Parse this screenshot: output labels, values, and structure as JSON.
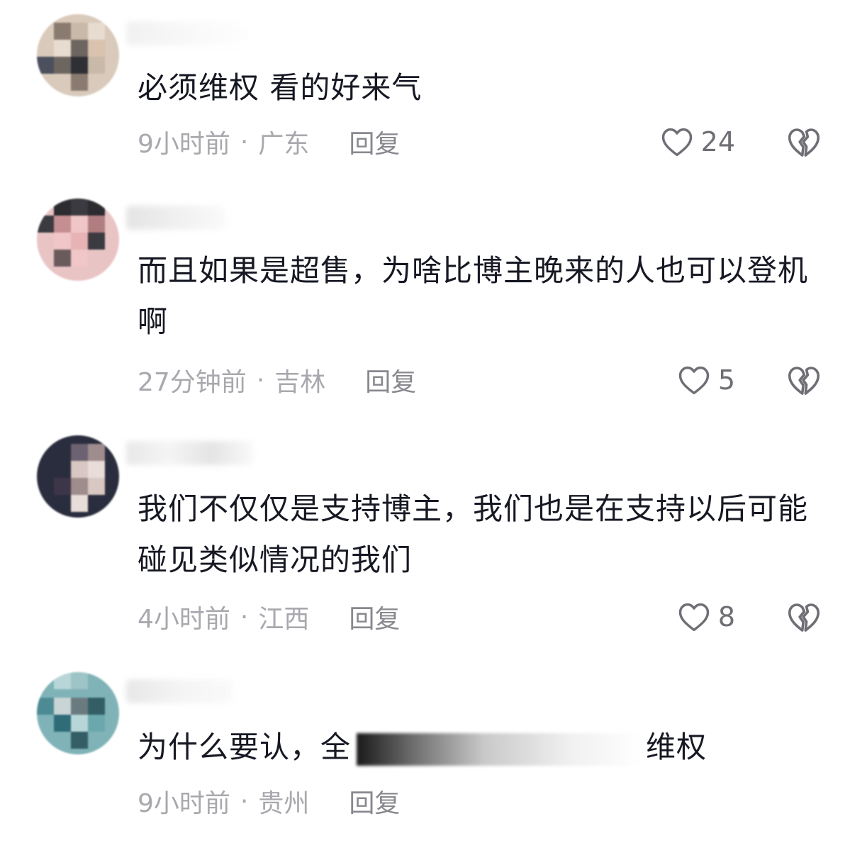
{
  "comments": [
    {
      "text": "必须维权 看的好来气",
      "time": "9小时前",
      "location": "广东",
      "reply_label": "回复",
      "likes": "24",
      "avatar_colors": [
        "#c9b9a8",
        "#8a7b70",
        "#e8dcd0",
        "#4b4f5e",
        "#d9c2ae",
        "#6d6660"
      ]
    },
    {
      "text": "而且如果是超售，为啥比博主晚来的人也可以登机啊",
      "time": "27分钟前",
      "location": "吉林",
      "reply_label": "回复",
      "likes": "5",
      "avatar_colors": [
        "#3a3a40",
        "#f0c6c8",
        "#c58f92",
        "#e7b3b5",
        "#2b2b30",
        "#b07e80"
      ]
    },
    {
      "text": "我们不仅仅是支持博主，我们也是在支持以后可能碰见类似情况的我们",
      "time": "4小时前",
      "location": "江西",
      "reply_label": "回复",
      "likes": "8",
      "avatar_colors": [
        "#1d2233",
        "#9f8c8c",
        "#d8c7c2",
        "#3c3648",
        "#6c6271",
        "#e8ddd8"
      ]
    },
    {
      "text_before": "为什么要认，全",
      "text_after": "维权",
      "time": "9小时前",
      "location": "贵州",
      "reply_label": "回复",
      "avatar_colors": [
        "#6aa8ad",
        "#2e6c78",
        "#b8d6d8",
        "#4d8b94",
        "#9fc4c7",
        "#335e66"
      ]
    }
  ],
  "colors": {
    "text": "#161823",
    "meta": "#a8a8ae",
    "reply": "#88888f",
    "icon": "#6e6e75"
  }
}
